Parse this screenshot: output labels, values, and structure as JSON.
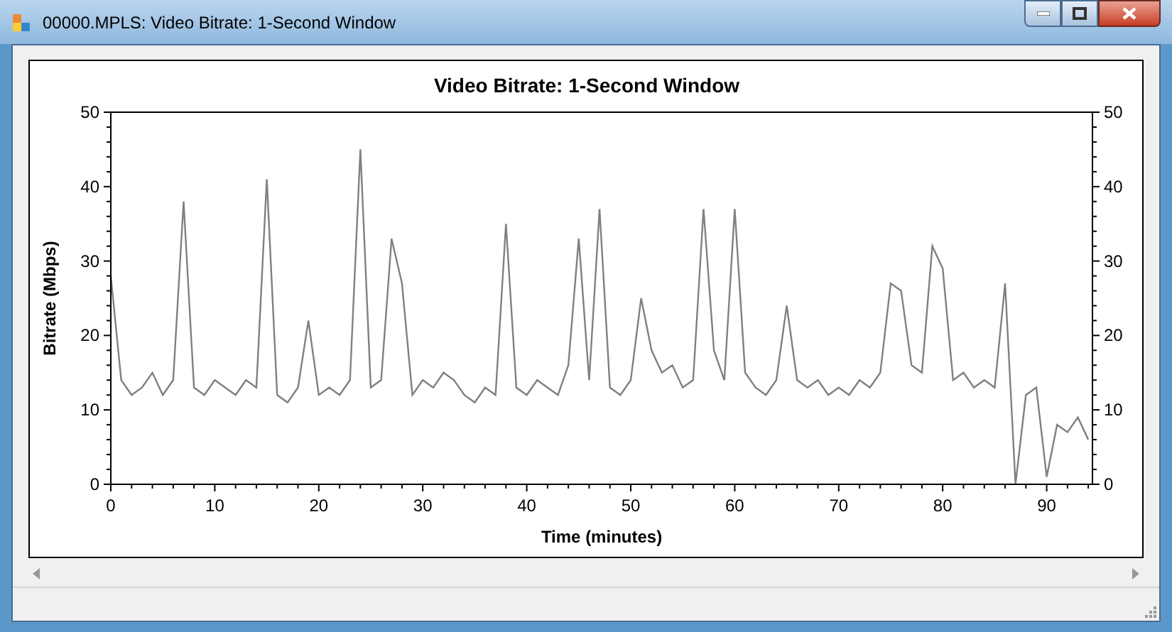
{
  "window": {
    "title": "00000.MPLS: Video Bitrate: 1-Second Window"
  },
  "chart": {
    "chart_data": {
      "type": "line",
      "title": "Video Bitrate: 1-Second Window",
      "xlabel": "Time (minutes)",
      "ylabel": "Bitrate (Mbps)",
      "xlim": [
        0,
        94.4
      ],
      "ylim": [
        0,
        50
      ],
      "xticks": [
        0,
        10,
        20,
        30,
        40,
        50,
        60,
        70,
        80,
        90
      ],
      "yticks": [
        0,
        10,
        20,
        30,
        40,
        50
      ],
      "y2ticks": [
        0,
        10,
        20,
        30,
        40,
        50
      ],
      "y2lim": [
        0,
        50
      ],
      "x": [
        0,
        1,
        2,
        3,
        4,
        5,
        6,
        7,
        8,
        9,
        10,
        11,
        12,
        13,
        14,
        15,
        16,
        17,
        18,
        19,
        20,
        21,
        22,
        23,
        24,
        25,
        26,
        27,
        28,
        29,
        30,
        31,
        32,
        33,
        34,
        35,
        36,
        37,
        38,
        39,
        40,
        41,
        42,
        43,
        44,
        45,
        46,
        47,
        48,
        49,
        50,
        51,
        52,
        53,
        54,
        55,
        56,
        57,
        58,
        59,
        60,
        61,
        62,
        63,
        64,
        65,
        66,
        67,
        68,
        69,
        70,
        71,
        72,
        73,
        74,
        75,
        76,
        77,
        78,
        79,
        80,
        81,
        82,
        83,
        84,
        85,
        86,
        87,
        88,
        89,
        90,
        91,
        92,
        93,
        94
      ],
      "series": [
        {
          "color": "#808080",
          "values": [
            28,
            14,
            12,
            13,
            15,
            12,
            14,
            38,
            13,
            12,
            14,
            13,
            12,
            14,
            13,
            41,
            12,
            11,
            13,
            22,
            12,
            13,
            12,
            14,
            45,
            13,
            14,
            33,
            27,
            12,
            14,
            13,
            15,
            14,
            12,
            11,
            13,
            12,
            35,
            13,
            12,
            14,
            13,
            12,
            16,
            33,
            14,
            37,
            13,
            12,
            14,
            25,
            18,
            15,
            16,
            13,
            14,
            37,
            18,
            14,
            37,
            15,
            13,
            12,
            14,
            24,
            14,
            13,
            14,
            12,
            13,
            12,
            14,
            13,
            15,
            27,
            26,
            16,
            15,
            32,
            29,
            14,
            15,
            13,
            14,
            13,
            27,
            0,
            12,
            13,
            1,
            8,
            7,
            9,
            6
          ]
        }
      ]
    }
  }
}
